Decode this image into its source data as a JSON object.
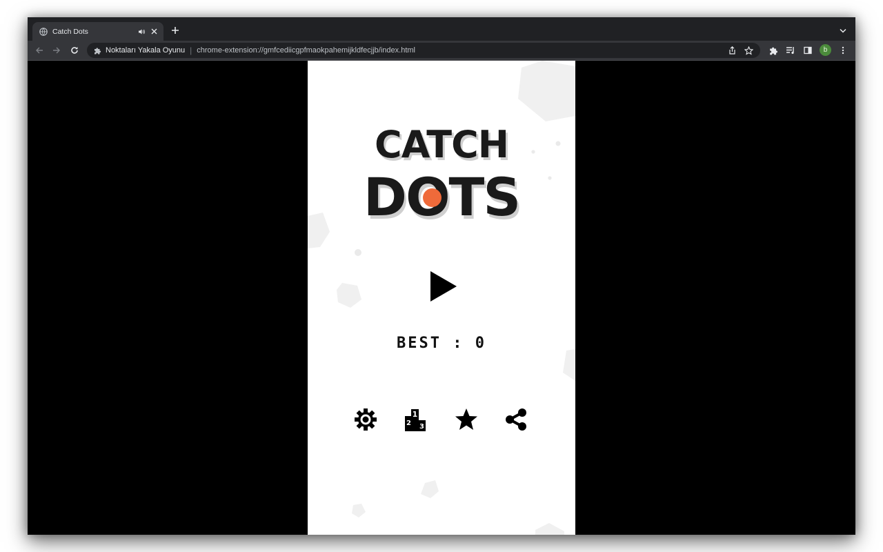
{
  "browser": {
    "tab": {
      "title": "Catch Dots",
      "icons": [
        "globe-icon",
        "speaker-icon",
        "close-icon"
      ]
    },
    "toolbar": {
      "site_name": "Noktaları Yakala Oyunu",
      "url": "chrome-extension://gmfcediicgpfmaokpahemijkldfecjjb/index.html",
      "avatar_letter": "b",
      "avatar_color": "#4b8b3b"
    }
  },
  "game": {
    "title_line1": "CATCH",
    "title_line2": "DOTS",
    "best_label": "BEST : 0",
    "accent_color": "#ef6a3a",
    "menu_icons": [
      "settings-gear-icon",
      "leaderboard-podium-icon",
      "rate-star-icon",
      "share-icon"
    ]
  }
}
